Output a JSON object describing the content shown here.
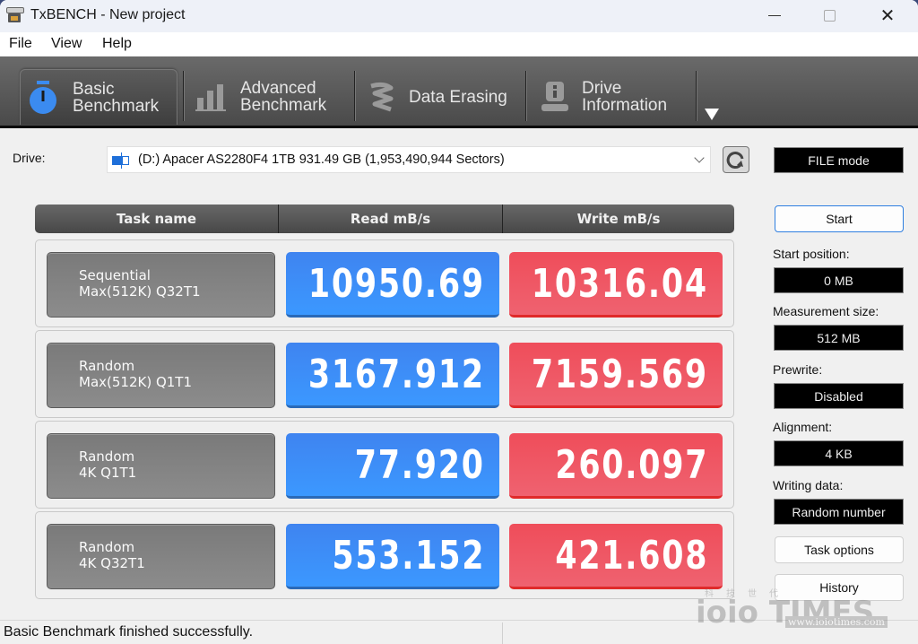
{
  "window": {
    "title": "TxBENCH - New project",
    "controls": {
      "minimize": "minimize",
      "maximize": "maximize",
      "close": "✕"
    }
  },
  "menu": [
    "File",
    "View",
    "Help"
  ],
  "toolbar": {
    "tabs": [
      {
        "label": "Basic\nBenchmark",
        "icon": "stopwatch-icon",
        "active": true
      },
      {
        "label": "Advanced\nBenchmark",
        "icon": "bar-chart-icon",
        "active": false
      },
      {
        "label": "Data Erasing",
        "icon": "eraser-icon",
        "active": false
      },
      {
        "label": "Drive\nInformation",
        "icon": "drive-info-icon",
        "active": false
      }
    ],
    "more": "more-tabs-arrow"
  },
  "drive": {
    "label": "Drive:",
    "selected": "(D:) Apacer AS2280F4 1TB  931.49 GB (1,953,490,944 Sectors)",
    "mode": "FILE mode"
  },
  "table": {
    "headers": [
      "Task name",
      "Read mB/s",
      "Write mB/s"
    ],
    "rows": [
      {
        "task": "Sequential\nMax(512K) Q32T1",
        "read": "10950.69",
        "write": "10316.04"
      },
      {
        "task": "Random\nMax(512K) Q1T1",
        "read": "3167.912",
        "write": "7159.569"
      },
      {
        "task": "Random\n4K Q1T1",
        "read": "77.920",
        "write": "260.097"
      },
      {
        "task": "Random\n4K Q32T1",
        "read": "553.152",
        "write": "421.608"
      }
    ]
  },
  "sidebar": {
    "start_button": "Start",
    "fields": [
      {
        "label": "Start position:",
        "value": "0 MB"
      },
      {
        "label": "Measurement size:",
        "value": "512 MB"
      },
      {
        "label": "Prewrite:",
        "value": "Disabled"
      },
      {
        "label": "Alignment:",
        "value": "4 KB"
      },
      {
        "label": "Writing data:",
        "value": "Random number"
      }
    ],
    "task_options_button": "Task options",
    "history_button": "History"
  },
  "status": {
    "message": "Basic Benchmark finished successfully."
  },
  "watermark": {
    "cn": "科技世代",
    "logo": "ioio TIMES",
    "url": "www.ioiotimes.com"
  },
  "colors": {
    "read": "#3d8ef8",
    "write": "#ef5562",
    "toolbar": "#5a5a5a",
    "start_border": "#2f7fe0"
  }
}
